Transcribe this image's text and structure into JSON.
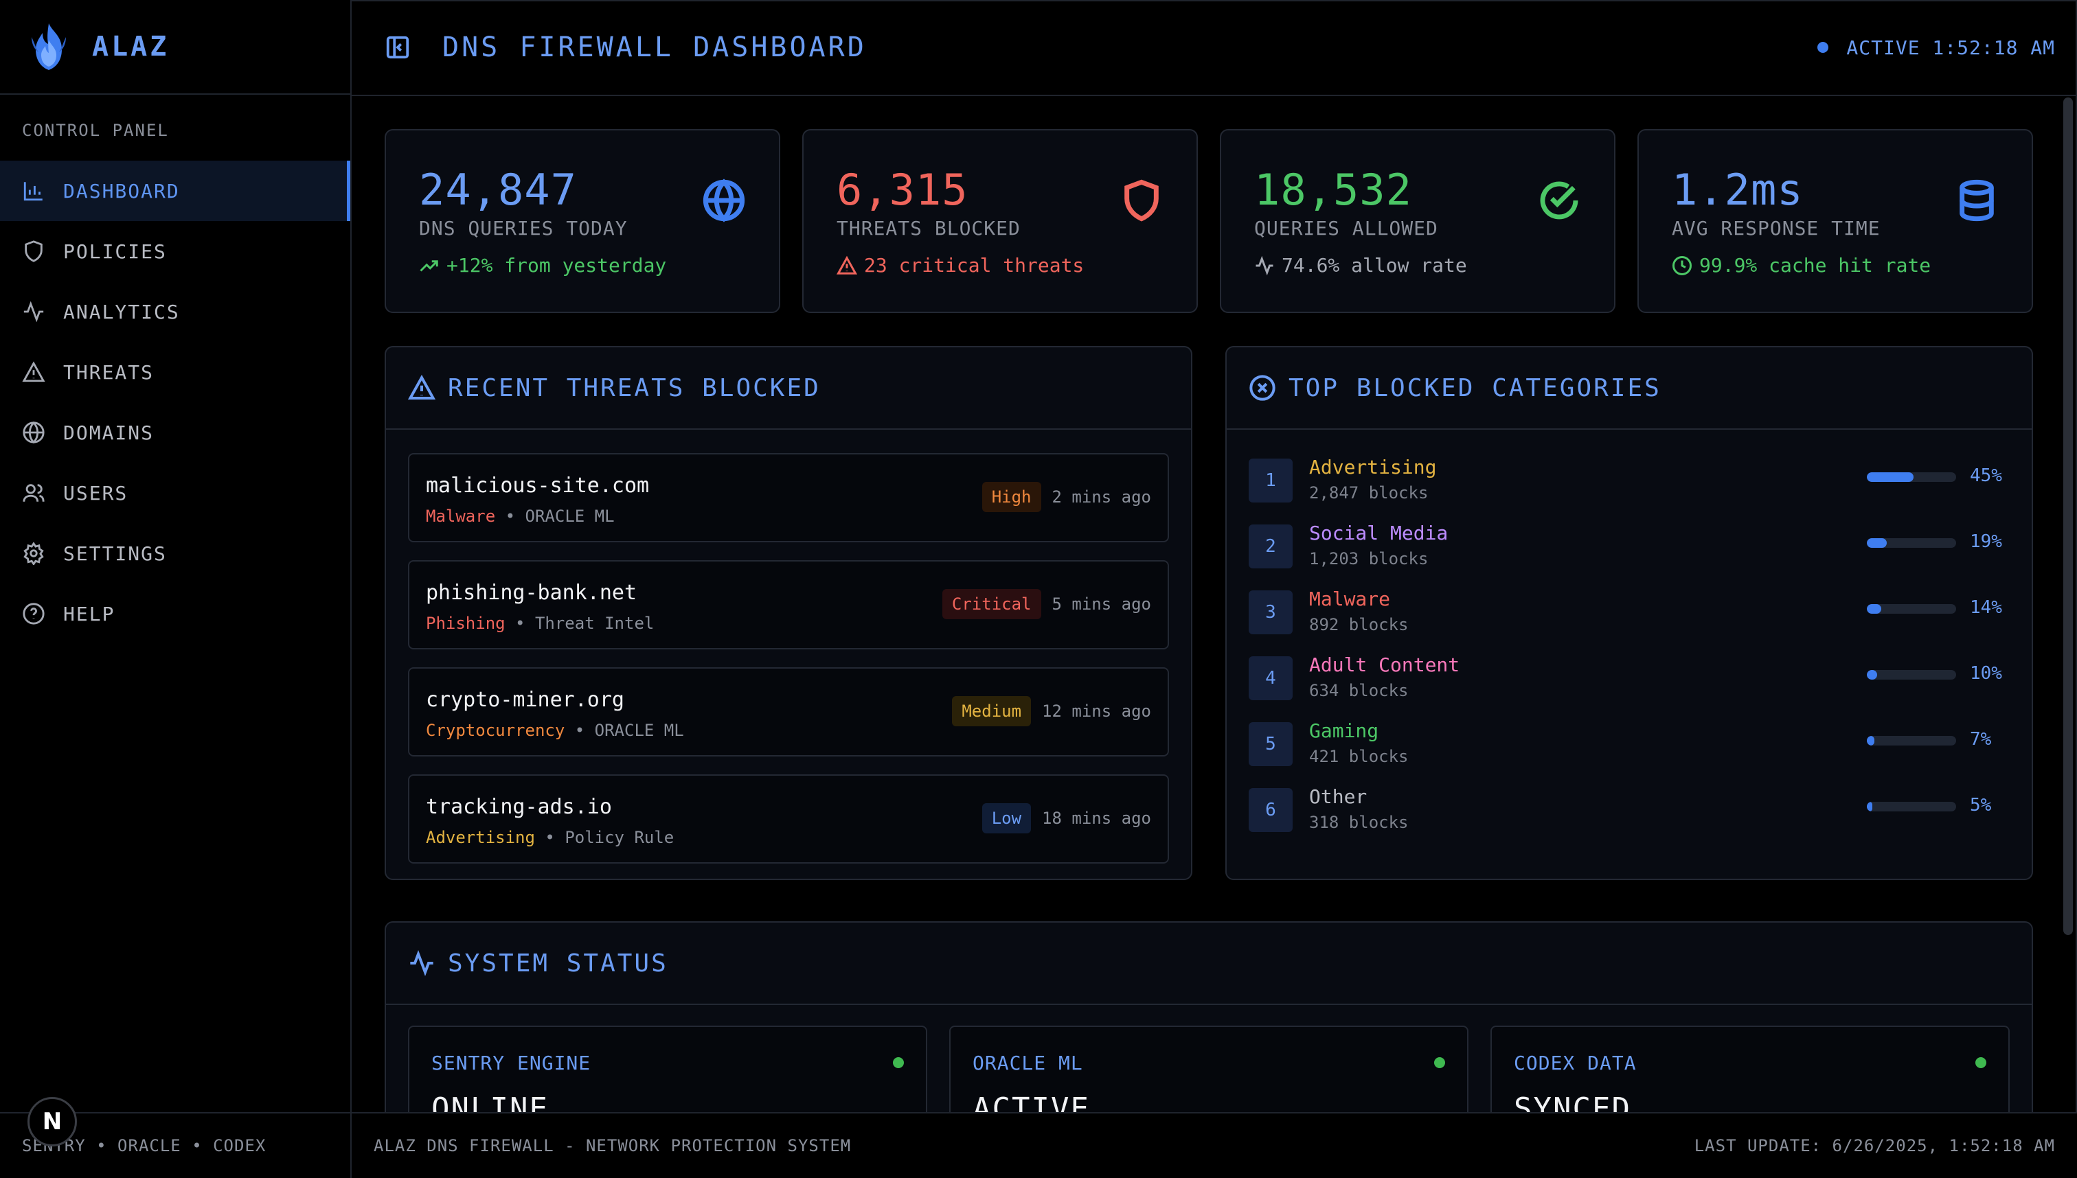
{
  "brand": {
    "name": "ALAZ"
  },
  "sidebar": {
    "section_label": "CONTROL PANEL",
    "items": [
      {
        "label": "DASHBOARD",
        "icon": "bar-chart-icon",
        "active": true
      },
      {
        "label": "POLICIES",
        "icon": "shield-icon"
      },
      {
        "label": "ANALYTICS",
        "icon": "activity-icon"
      },
      {
        "label": "THREATS",
        "icon": "warning-icon"
      },
      {
        "label": "DOMAINS",
        "icon": "globe-icon"
      },
      {
        "label": "USERS",
        "icon": "users-icon"
      },
      {
        "label": "SETTINGS",
        "icon": "gear-icon"
      },
      {
        "label": "HELP",
        "icon": "help-icon"
      }
    ],
    "footer": "SENTRY • ORACLE • CODEX"
  },
  "header": {
    "title": "DNS FIREWALL DASHBOARD",
    "status": "ACTIVE 1:52:18 AM"
  },
  "stats": [
    {
      "value": "24,847",
      "label": "DNS QUERIES TODAY",
      "sub": "+12% from yesterday",
      "color": "#6b9cf3",
      "sub_color": "#4cc766",
      "icon": "globe-icon",
      "sub_icon": "trending-up-icon"
    },
    {
      "value": "6,315",
      "label": "THREATS BLOCKED",
      "sub": "23 critical threats",
      "color": "#f0655c",
      "sub_color": "#f0655c",
      "icon": "shield-icon",
      "sub_icon": "warning-icon"
    },
    {
      "value": "18,532",
      "label": "QUERIES ALLOWED",
      "sub": "74.6% allow rate",
      "color": "#4cc766",
      "sub_color": "#a5a9b3",
      "icon": "check-circle-icon",
      "sub_icon": "activity-icon"
    },
    {
      "value": "1.2ms",
      "label": "AVG RESPONSE TIME",
      "sub": "99.9% cache hit rate",
      "color": "#6b9cf3",
      "sub_color": "#4cc766",
      "icon": "database-icon",
      "sub_icon": "clock-icon"
    }
  ],
  "threats_panel": {
    "title": "RECENT THREATS BLOCKED",
    "items": [
      {
        "domain": "malicious-site.com",
        "category": "Malware",
        "category_color": "#f0655c",
        "source": "ORACLE ML",
        "severity": "High",
        "severity_color": "#f0883e",
        "severity_bg": "#2a1608",
        "time": "2 mins ago"
      },
      {
        "domain": "phishing-bank.net",
        "category": "Phishing",
        "category_color": "#f0655c",
        "source": "Threat Intel",
        "severity": "Critical",
        "severity_color": "#f0655c",
        "severity_bg": "#2a0e10",
        "time": "5 mins ago"
      },
      {
        "domain": "crypto-miner.org",
        "category": "Cryptocurrency",
        "category_color": "#f0883e",
        "source": "ORACLE ML",
        "severity": "Medium",
        "severity_color": "#e3b341",
        "severity_bg": "#2a2108",
        "time": "12 mins ago"
      },
      {
        "domain": "tracking-ads.io",
        "category": "Advertising",
        "category_color": "#e3b341",
        "source": "Policy Rule",
        "severity": "Low",
        "severity_color": "#6b9cf3",
        "severity_bg": "#101d36",
        "time": "18 mins ago"
      }
    ]
  },
  "categories_panel": {
    "title": "TOP BLOCKED CATEGORIES",
    "items": [
      {
        "rank": "1",
        "name": "Advertising",
        "color": "#e3b341",
        "count": "2,847 blocks",
        "percent": 45,
        "percent_label": "45%"
      },
      {
        "rank": "2",
        "name": "Social Media",
        "color": "#bc8cff",
        "count": "1,203 blocks",
        "percent": 19,
        "percent_label": "19%"
      },
      {
        "rank": "3",
        "name": "Malware",
        "color": "#f0655c",
        "count": "892 blocks",
        "percent": 14,
        "percent_label": "14%"
      },
      {
        "rank": "4",
        "name": "Adult Content",
        "color": "#f778ba",
        "count": "634 blocks",
        "percent": 10,
        "percent_label": "10%"
      },
      {
        "rank": "5",
        "name": "Gaming",
        "color": "#4cc766",
        "count": "421 blocks",
        "percent": 7,
        "percent_label": "7%"
      },
      {
        "rank": "6",
        "name": "Other",
        "color": "#b9bcc4",
        "count": "318 blocks",
        "percent": 5,
        "percent_label": "5%"
      }
    ]
  },
  "system_panel": {
    "title": "SYSTEM STATUS",
    "items": [
      {
        "name": "SENTRY ENGINE",
        "value": "ONLINE"
      },
      {
        "name": "ORACLE ML",
        "value": "ACTIVE"
      },
      {
        "name": "CODEX DATA",
        "value": "SYNCED"
      }
    ]
  },
  "footer": {
    "left": "ALAZ DNS FIREWALL - NETWORK PROTECTION SYSTEM",
    "right": "LAST UPDATE: 6/26/2025, 1:52:18 AM"
  },
  "badge_letter": "N"
}
